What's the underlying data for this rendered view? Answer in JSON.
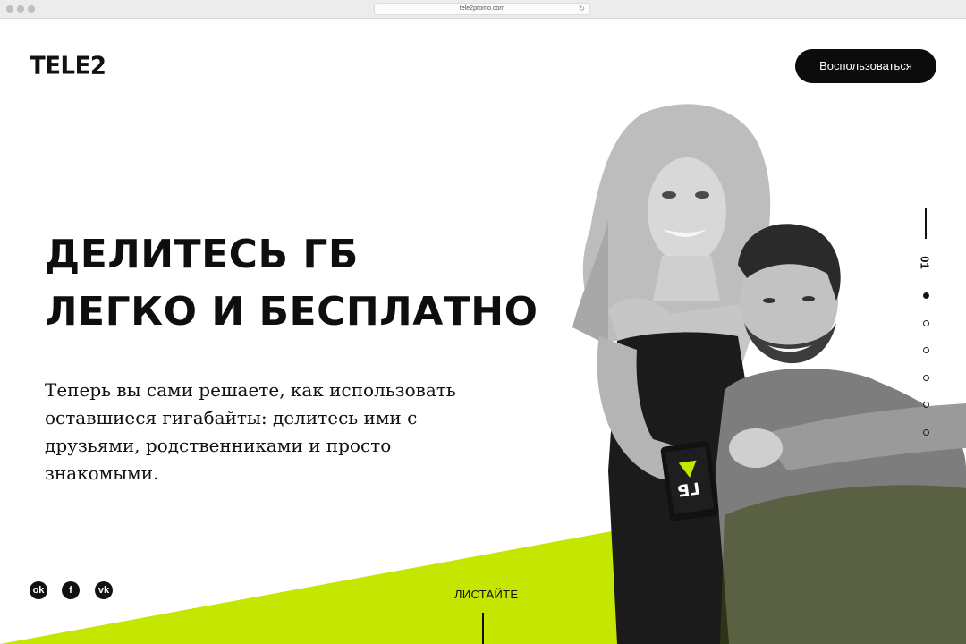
{
  "browser": {
    "url": "tele2promo.com"
  },
  "header": {
    "logo_text": "TELE2",
    "cta_label": "Воспользоваться"
  },
  "hero": {
    "headline_line1": "ДЕЛИТЕСЬ ГБ",
    "headline_line2": "ЛЕГКО И БЕСПЛАТНО",
    "lead": "Теперь вы сами решаете, как использовать оставшиеся гигабайты: делитесь ими с друзьями, родственниками и просто знакомыми.",
    "phone_screen_text": "ГБ"
  },
  "pager": {
    "current": "01",
    "total_dots": 6,
    "active_index": 0
  },
  "social": {
    "items": [
      {
        "name": "odnoklassniki-icon",
        "glyph": "ok"
      },
      {
        "name": "facebook-icon",
        "glyph": "f"
      },
      {
        "name": "vk-icon",
        "glyph": "vk"
      }
    ]
  },
  "scroll": {
    "label": "ЛИСТАЙТЕ"
  },
  "colors": {
    "accent": "#c4e600",
    "dark": "#0c0c0c",
    "background": "#ffffff"
  }
}
